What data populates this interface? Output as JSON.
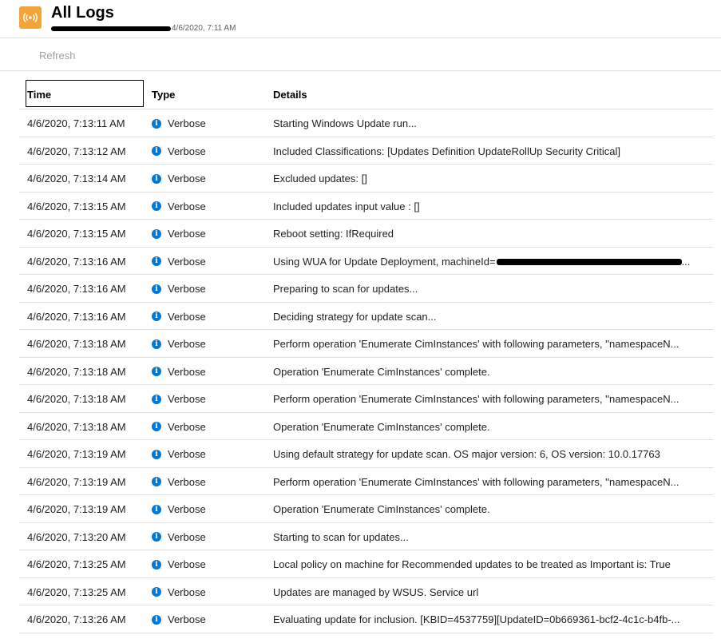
{
  "header": {
    "title": "All Logs",
    "timestamp": "4/6/2020, 7:11 AM",
    "accent_color": "#f2a33a",
    "icon": "broadcast-icon"
  },
  "toolbar": {
    "refresh_label": "Refresh"
  },
  "grid": {
    "columns": {
      "time": "Time",
      "type": "Type",
      "details": "Details"
    },
    "rows": [
      {
        "time": "4/6/2020, 7:13:11 AM",
        "type": "Verbose",
        "details": "Starting Windows Update run..."
      },
      {
        "time": "4/6/2020, 7:13:12 AM",
        "type": "Verbose",
        "details": "Included Classifications: [Updates Definition UpdateRollUp Security Critical]"
      },
      {
        "time": "4/6/2020, 7:13:14 AM",
        "type": "Verbose",
        "details": "Excluded updates: []"
      },
      {
        "time": "4/6/2020, 7:13:15 AM",
        "type": "Verbose",
        "details": "Included updates input value : []"
      },
      {
        "time": "4/6/2020, 7:13:15 AM",
        "type": "Verbose",
        "details": "Reboot setting: IfRequired"
      },
      {
        "time": "4/6/2020, 7:13:16 AM",
        "type": "Verbose",
        "details": "Using WUA for Update Deployment, machineId=",
        "redacted": true,
        "trail": "..."
      },
      {
        "time": "4/6/2020, 7:13:16 AM",
        "type": "Verbose",
        "details": "Preparing to scan for updates..."
      },
      {
        "time": "4/6/2020, 7:13:16 AM",
        "type": "Verbose",
        "details": "Deciding strategy for update scan..."
      },
      {
        "time": "4/6/2020, 7:13:18 AM",
        "type": "Verbose",
        "details": "Perform operation 'Enumerate CimInstances' with following parameters, ''namespaceN..."
      },
      {
        "time": "4/6/2020, 7:13:18 AM",
        "type": "Verbose",
        "details": "Operation 'Enumerate CimInstances' complete."
      },
      {
        "time": "4/6/2020, 7:13:18 AM",
        "type": "Verbose",
        "details": "Perform operation 'Enumerate CimInstances' with following parameters, ''namespaceN..."
      },
      {
        "time": "4/6/2020, 7:13:18 AM",
        "type": "Verbose",
        "details": "Operation 'Enumerate CimInstances' complete."
      },
      {
        "time": "4/6/2020, 7:13:19 AM",
        "type": "Verbose",
        "details": "Using default strategy for update scan. OS major version: 6, OS version: 10.0.17763"
      },
      {
        "time": "4/6/2020, 7:13:19 AM",
        "type": "Verbose",
        "details": "Perform operation 'Enumerate CimInstances' with following parameters, ''namespaceN..."
      },
      {
        "time": "4/6/2020, 7:13:19 AM",
        "type": "Verbose",
        "details": "Operation 'Enumerate CimInstances' complete."
      },
      {
        "time": "4/6/2020, 7:13:20 AM",
        "type": "Verbose",
        "details": "Starting to scan for updates..."
      },
      {
        "time": "4/6/2020, 7:13:25 AM",
        "type": "Verbose",
        "details": "Local policy on machine for Recommended updates to be treated as Important is: True"
      },
      {
        "time": "4/6/2020, 7:13:25 AM",
        "type": "Verbose",
        "details": "Updates are managed by WSUS. Service url"
      },
      {
        "time": "4/6/2020, 7:13:26 AM",
        "type": "Verbose",
        "details": "Evaluating update for inclusion. [KBID=4537759][UpdateID=0b669361-bcf2-4c1c-b4fb-..."
      }
    ]
  }
}
